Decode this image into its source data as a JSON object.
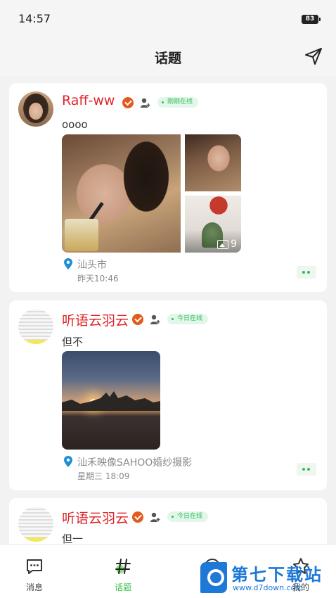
{
  "status_bar": {
    "time": "14:57",
    "battery": "83"
  },
  "header": {
    "title": "话题",
    "send_icon": "send-icon"
  },
  "posts": [
    {
      "username": "Raff-ww",
      "online_status": "刚刚在线",
      "text": "oooo",
      "image_count": "9",
      "location": "汕头市",
      "time": "昨天10:46"
    },
    {
      "username": "听语云羽云",
      "online_status": "今日在线",
      "text": "但不",
      "location": "汕禾映像SAHOO婚纱摄影",
      "time": "星期三 18:09"
    },
    {
      "username": "听语云羽云",
      "online_status": "今日在线",
      "text": "但一"
    }
  ],
  "bottom_nav": [
    {
      "label": "消息",
      "icon": "chat-icon",
      "active": false
    },
    {
      "label": "话题",
      "icon": "hashtag-icon",
      "active": true
    },
    {
      "label": "",
      "icon": "discover-icon",
      "active": false
    },
    {
      "label": "我的",
      "icon": "profile-icon",
      "active": false
    }
  ],
  "watermark": {
    "title": "第七下载站",
    "url": "www.d7down.com"
  },
  "colors": {
    "accent": "#3cbf4a",
    "username": "#e0262b",
    "online": "#2fbe5b"
  }
}
